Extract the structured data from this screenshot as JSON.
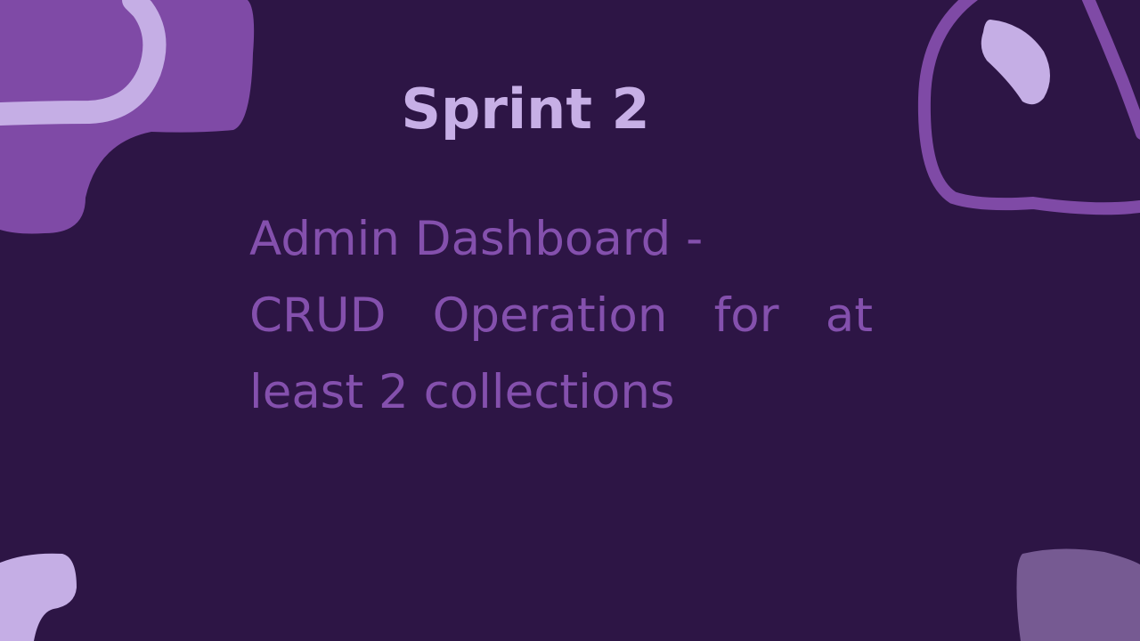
{
  "slide": {
    "title": "Sprint 2",
    "body": {
      "line1": "Admin Dashboard -",
      "line2_words": [
        "CRUD",
        "Operation",
        "for",
        "at"
      ],
      "line3": "least 2 collections"
    }
  },
  "colors": {
    "background": "#2d1545",
    "title": "#c7afe6",
    "body_text": "#8450ad",
    "blob_purple": "#7f4aa6",
    "blob_lavender": "#c5aee5",
    "blob_muted": "#765a92"
  }
}
